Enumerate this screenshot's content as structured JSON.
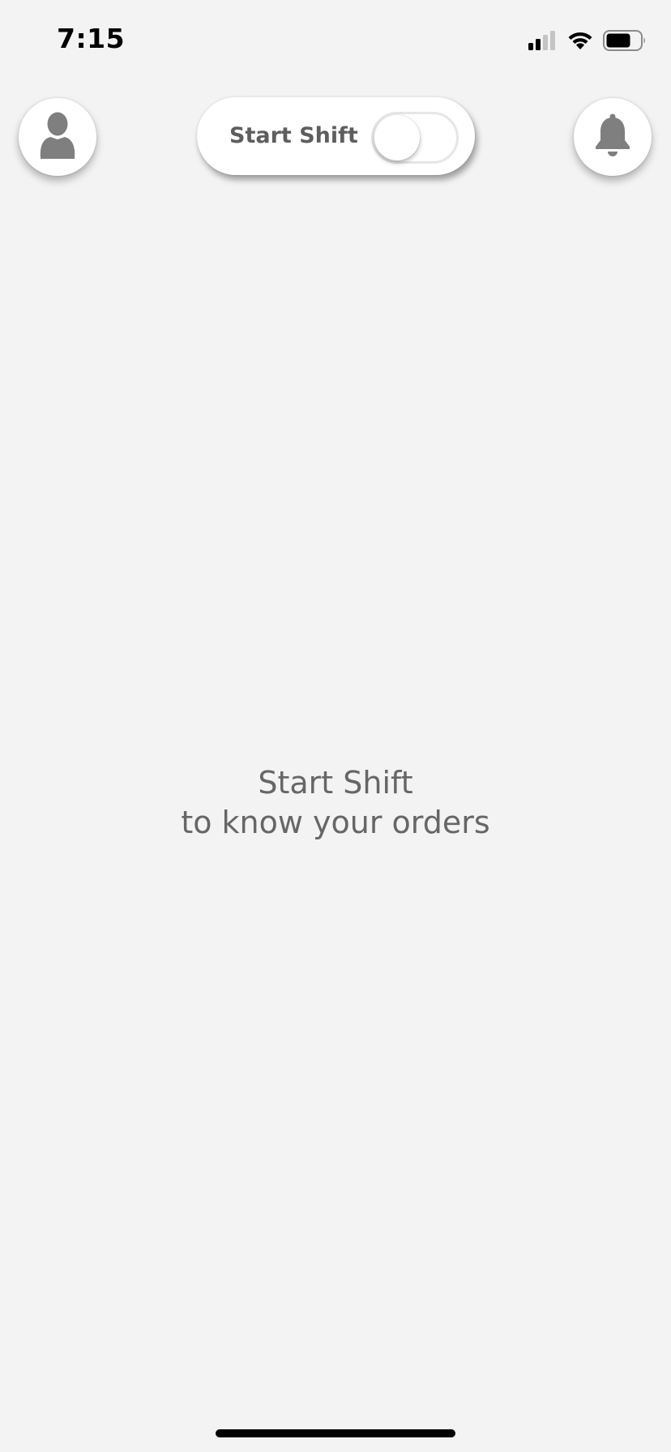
{
  "status_bar": {
    "time": "7:15",
    "icons": [
      "cellular-signal-icon",
      "wifi-icon",
      "battery-icon"
    ]
  },
  "header": {
    "profile_icon": "person-icon",
    "shift_toggle": {
      "label": "Start Shift",
      "on": false
    },
    "notifications_icon": "bell-icon"
  },
  "main": {
    "message_line1": "Start Shift",
    "message_line2": "to know your orders"
  },
  "colors": {
    "background": "#f3f3f3",
    "text_gray": "#666666",
    "icon_gray": "#7f7f7f"
  }
}
